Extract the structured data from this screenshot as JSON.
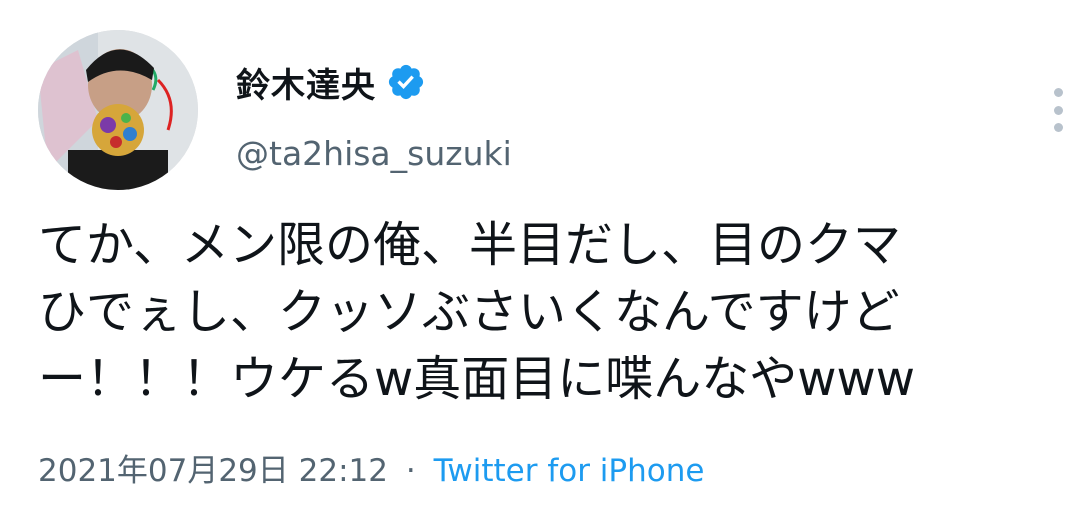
{
  "tweet": {
    "display_name": "鈴木達央",
    "handle": "@ta2hisa_suzuki",
    "verified": true,
    "text_lines": [
      "てか、メン限の俺、半目だし、目のクマ",
      "ひでぇし、クッソぶさいくなんですけど",
      "ー！！！ウケるw真面目に喋んなやwww"
    ],
    "timestamp": "2021年07月29日 22:12",
    "separator": "·",
    "source": "Twitter for iPhone"
  },
  "icons": {
    "verified": "verified-badge-icon",
    "more": "more-options-icon"
  },
  "colors": {
    "text": "#0f1419",
    "secondary": "#536471",
    "accent": "#1d9bf0",
    "more_dots": "#b8c2cc"
  }
}
